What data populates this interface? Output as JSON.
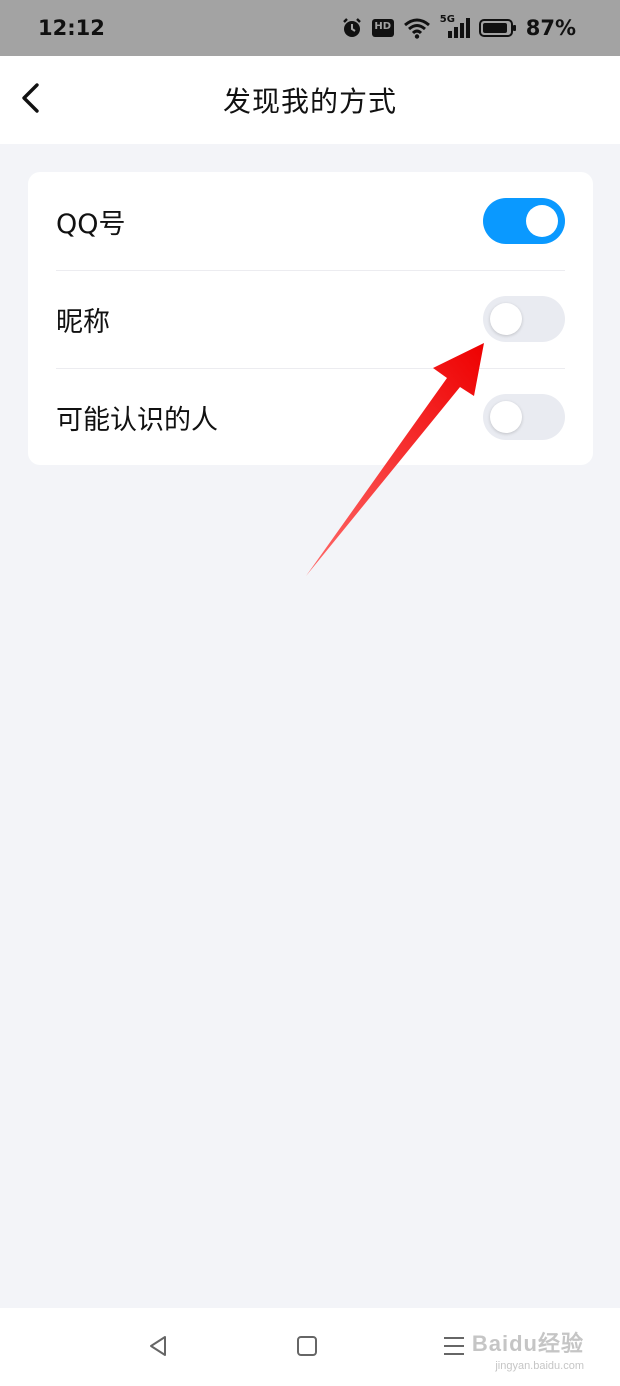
{
  "status_bar": {
    "time": "12:12",
    "icons": [
      "alarm-icon",
      "hd-icon",
      "wifi-icon",
      "5g-signal-icon",
      "battery-icon"
    ],
    "hd_label": "HD",
    "network_label": "5G",
    "battery": "87%"
  },
  "header": {
    "title": "发现我的方式",
    "back_icon": "chevron-left-icon"
  },
  "settings": [
    {
      "label": "QQ号",
      "enabled": true
    },
    {
      "label": "昵称",
      "enabled": false
    },
    {
      "label": "可能认识的人",
      "enabled": false
    }
  ],
  "annotation": {
    "type": "red-arrow",
    "color": "#ff1f1f"
  },
  "nav_bar": {
    "icons": [
      "back-triangle-icon",
      "home-square-icon",
      "menu-lines-icon"
    ]
  },
  "watermark": {
    "main": "Baidu经验",
    "sub": "jingyan.baidu.com"
  },
  "colors": {
    "accent": "#0a99ff",
    "toggle_off": "#e9ebf1",
    "page_bg": "#f3f4f8",
    "status_bg": "#a3a3a3"
  }
}
